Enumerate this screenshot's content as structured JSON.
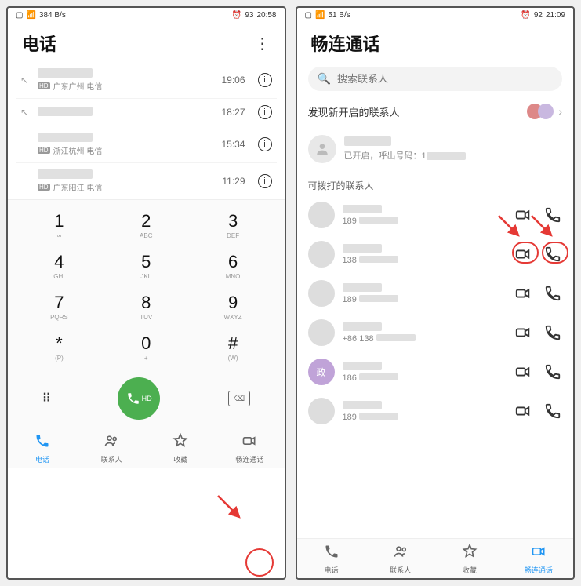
{
  "left": {
    "status": {
      "signal": "5G",
      "speed": "384 B/s",
      "battery": "93",
      "time": "20:58"
    },
    "title": "电话",
    "log": [
      {
        "sub": "广东广州 电信",
        "time": "19:06",
        "has_icon": true
      },
      {
        "sub": "",
        "time": "18:27",
        "has_icon": true
      },
      {
        "sub": "浙江杭州 电信",
        "time": "15:34",
        "has_icon": false
      },
      {
        "sub": "广东阳江 电信",
        "time": "11:29",
        "has_icon": false
      }
    ],
    "keys": [
      {
        "n": "1",
        "s": "∞"
      },
      {
        "n": "2",
        "s": "ABC"
      },
      {
        "n": "3",
        "s": "DEF"
      },
      {
        "n": "4",
        "s": "GHI"
      },
      {
        "n": "5",
        "s": "JKL"
      },
      {
        "n": "6",
        "s": "MNO"
      },
      {
        "n": "7",
        "s": "PQRS"
      },
      {
        "n": "8",
        "s": "TUV"
      },
      {
        "n": "9",
        "s": "WXYZ"
      },
      {
        "n": "*",
        "s": "(P)"
      },
      {
        "n": "0",
        "s": "+"
      },
      {
        "n": "#",
        "s": "(W)"
      }
    ],
    "call_hd": "HD",
    "nav": [
      {
        "icon": "phone",
        "label": "电话"
      },
      {
        "icon": "contacts",
        "label": "联系人"
      },
      {
        "icon": "star",
        "label": "收藏"
      },
      {
        "icon": "video",
        "label": "畅连通话"
      }
    ]
  },
  "right": {
    "status": {
      "signal": "5G",
      "speed": "51 B/s",
      "battery": "92",
      "time": "21:09"
    },
    "title": "畅连通话",
    "search_placeholder": "搜索联系人",
    "discover": "发现新开启的联系人",
    "self_sub": "已开启，呼出号码：1",
    "section": "可拨打的联系人",
    "contacts": [
      {
        "phone": "189"
      },
      {
        "phone": "138"
      },
      {
        "phone": "189"
      },
      {
        "phone": "+86 138"
      },
      {
        "phone": "186",
        "av_text": "政",
        "av_bg": "#c0a3d8"
      },
      {
        "phone": "189"
      }
    ],
    "nav": [
      {
        "icon": "phone",
        "label": "电话"
      },
      {
        "icon": "contacts",
        "label": "联系人"
      },
      {
        "icon": "star",
        "label": "收藏"
      },
      {
        "icon": "video",
        "label": "畅连通话"
      }
    ]
  }
}
